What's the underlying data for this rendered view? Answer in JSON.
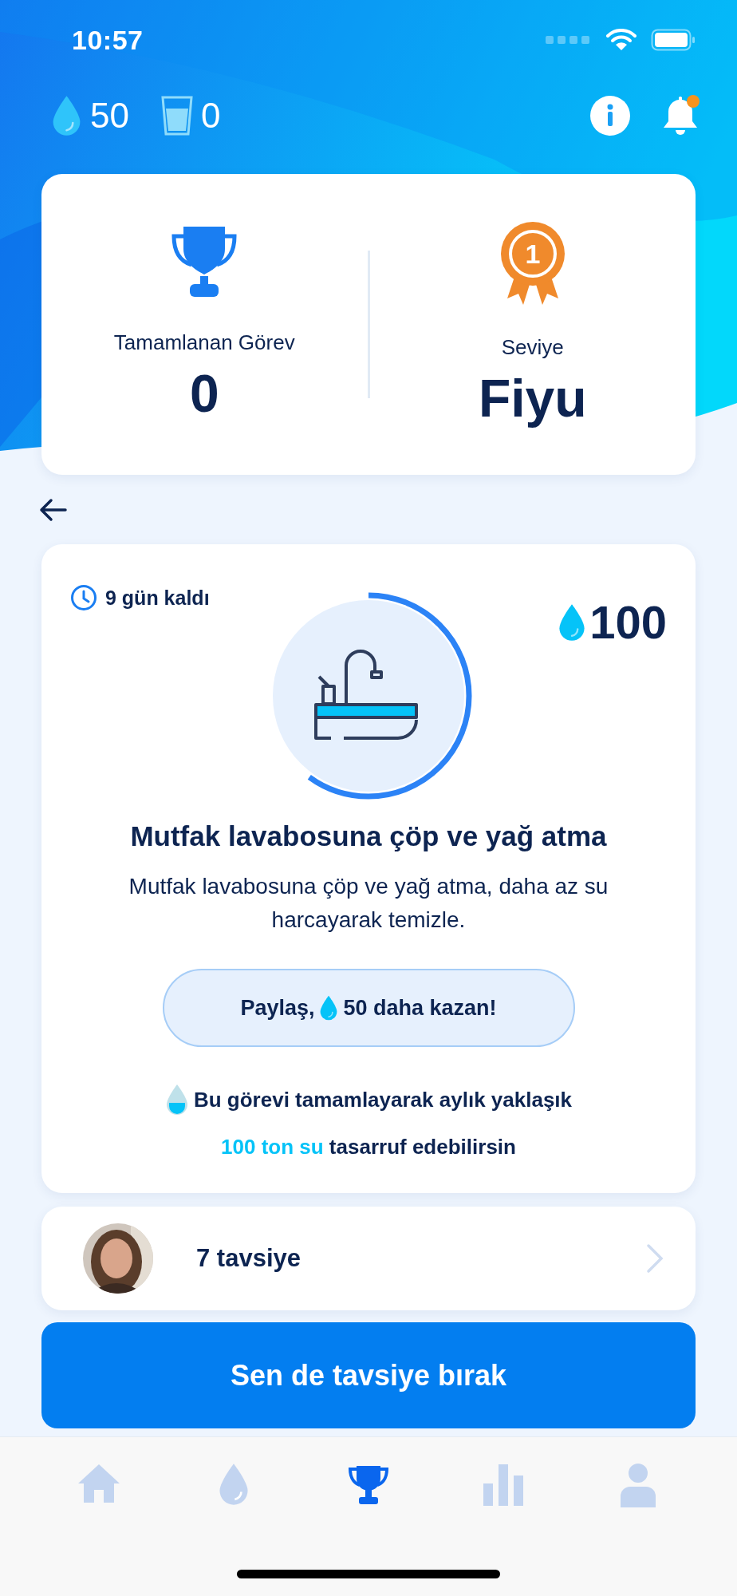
{
  "status_bar": {
    "time": "10:57"
  },
  "header": {
    "drops": "50",
    "glasses": "0",
    "notification_badge": true
  },
  "stats": {
    "completed_label": "Tamamlanan Görev",
    "completed_value": "0",
    "level_label": "Seviye",
    "level_value": "Fiyu",
    "level_badge": "1"
  },
  "task": {
    "time_left": "9 gün kaldı",
    "reward": "100",
    "progress": {
      "level": 0.6
    },
    "title": "Mutfak lavabosuna çöp ve yağ atma",
    "description": "Mutfak lavabosuna çöp ve yağ atma, daha az su harcayarak temizle.",
    "share_button": {
      "prefix": "Paylaş,",
      "suffix": "50 daha kazan!"
    },
    "savings": [
      "Bu görevi tamamlayarak aylık yaklaşık",
      "**100 ton su** tasarruf edebilirsin"
    ]
  },
  "reviews": {
    "count": "7 tavsiye"
  },
  "cta_button": "Sen de tavsiye bırak",
  "tab_bar": [
    {
      "kind": "home",
      "selected": false
    },
    {
      "kind": "drop",
      "selected": false
    },
    {
      "kind": "trophy",
      "selected": true
    },
    {
      "kind": "chart",
      "selected": false
    },
    {
      "kind": "profile",
      "selected": false
    }
  ]
}
